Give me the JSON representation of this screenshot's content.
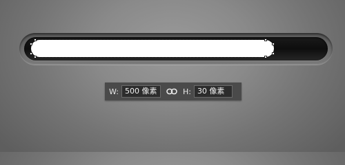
{
  "shape": {
    "fill_color": "#ffffff",
    "track_color": "#111111"
  },
  "dimensions": {
    "width_label": "W:",
    "width_value": "500 像素",
    "link_icon": "link-icon",
    "height_label": "H:",
    "height_value": "30 像素"
  }
}
